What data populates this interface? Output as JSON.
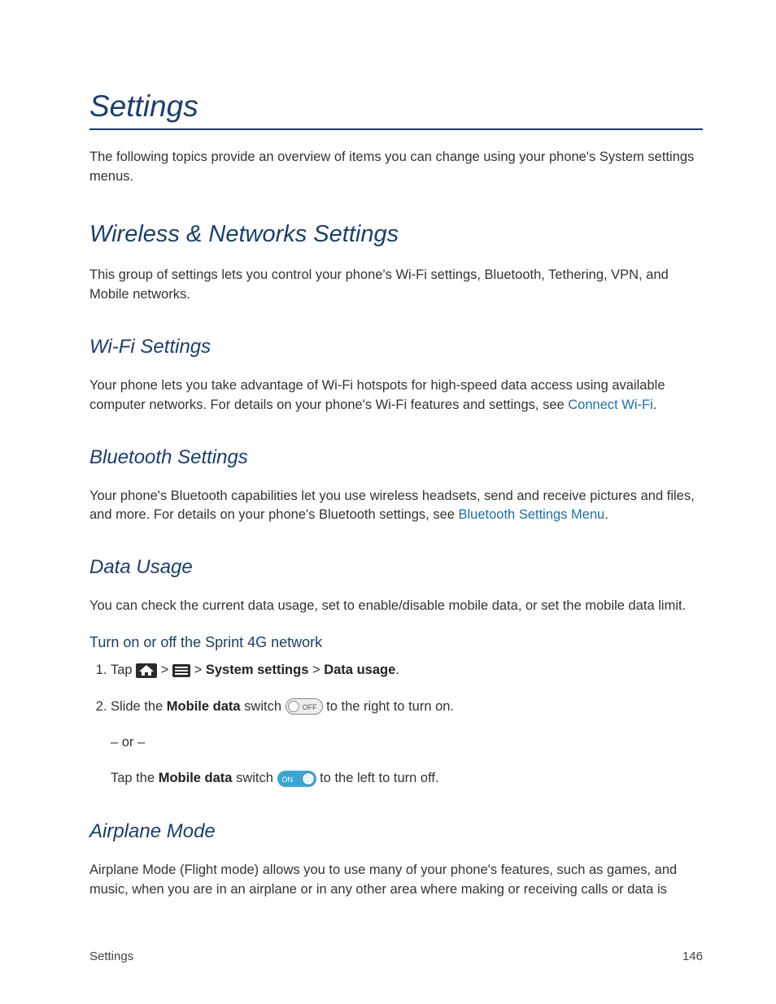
{
  "title": "Settings",
  "intro": "The following topics provide an overview of items you can change using your phone's System settings menus.",
  "wireless": {
    "heading": "Wireless & Networks Settings",
    "body": "This group of settings lets you control your phone's Wi-Fi settings, Bluetooth, Tethering, VPN, and Mobile networks."
  },
  "wifi": {
    "heading": "Wi-Fi Settings",
    "body_before_link": "Your phone lets you take advantage of Wi-Fi hotspots for high-speed data access using available computer networks. For details on your phone's Wi-Fi features and settings, see ",
    "link": "Connect Wi-Fi",
    "body_after_link": "."
  },
  "bluetooth": {
    "heading": "Bluetooth Settings",
    "body_before_link": "Your phone's Bluetooth capabilities let you use wireless headsets, send and receive pictures and files, and more. For details on your phone's Bluetooth settings, see ",
    "link": "Bluetooth Settings Menu",
    "body_after_link": "."
  },
  "datausage": {
    "heading": "Data Usage",
    "body": "You can check the current data usage, set to enable/disable mobile data, or set the mobile data limit.",
    "subheading": "Turn on or off the Sprint 4G network",
    "step1": {
      "tap": "Tap ",
      "gt": " > ",
      "system_settings": "System settings",
      "gt2": " > ",
      "data_usage": "Data usage",
      "period": "."
    },
    "step2": {
      "slide_the": "Slide the ",
      "mobile_data": "Mobile data",
      "switch_word": " switch ",
      "to_right": " to the right to turn on.",
      "or": "– or –",
      "tap_the": "Tap the ",
      "to_left": " to the left to turn off."
    },
    "off_label": "OFF",
    "on_label": "ON"
  },
  "airplane": {
    "heading": "Airplane Mode",
    "body": "Airplane Mode (Flight mode) allows you to use many of your phone's features, such as games, and music, when you are in an airplane or in any other area where making or receiving calls or data is"
  },
  "footer": {
    "left": "Settings",
    "right": "146"
  }
}
